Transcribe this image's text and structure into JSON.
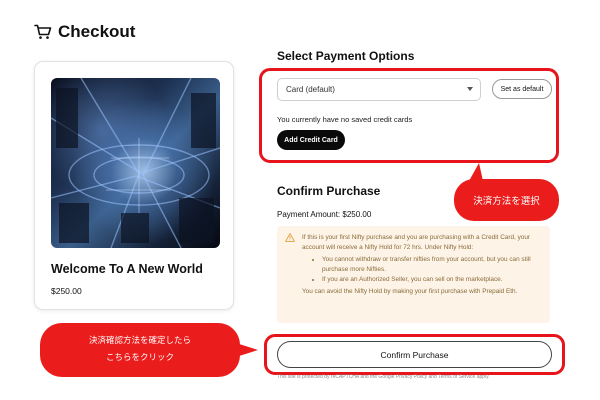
{
  "header": {
    "title": "Checkout",
    "icon": "cart-icon"
  },
  "product": {
    "title": "Welcome To A New World",
    "price": "$250.00"
  },
  "payment": {
    "section_title": "Select Payment Options",
    "selected_option": "Card (default)",
    "set_default_label": "Set as default",
    "no_cards_text": "You currently have no saved credit cards",
    "add_card_label": "Add Credit Card"
  },
  "confirm": {
    "section_title": "Confirm Purchase",
    "amount_text": "Payment Amount: $250.00",
    "button_label": "Confirm Purchase"
  },
  "warning": {
    "intro": "If this is your first Nifty purchase and you are purchasing with a Credit Card, your account will receive a Nifty Hold for 72 hrs. Under Nifty Hold:",
    "bullets": [
      "You cannot withdraw or transfer nifties from your account, but you can still purchase more Nifties.",
      "If you are an Authorized Seller, you can sell on the marketplace."
    ],
    "outro": "You can avoid the Nifty Hold by making your first purchase with Prepaid Eth."
  },
  "footnote": "This site is protected by reCAPTCHA and the Google Privacy Policy and Terms of Service apply.",
  "callouts": {
    "select_method": "決済方法を選択",
    "confirm_line1": "決済確認方法を確定したら",
    "confirm_line2": "こちらをクリック"
  },
  "colors": {
    "highlight_red": "#e8141c",
    "callout_red": "#ea1c1c",
    "warning_bg": "#fdf4e7",
    "warning_text": "#8a6a3a"
  }
}
